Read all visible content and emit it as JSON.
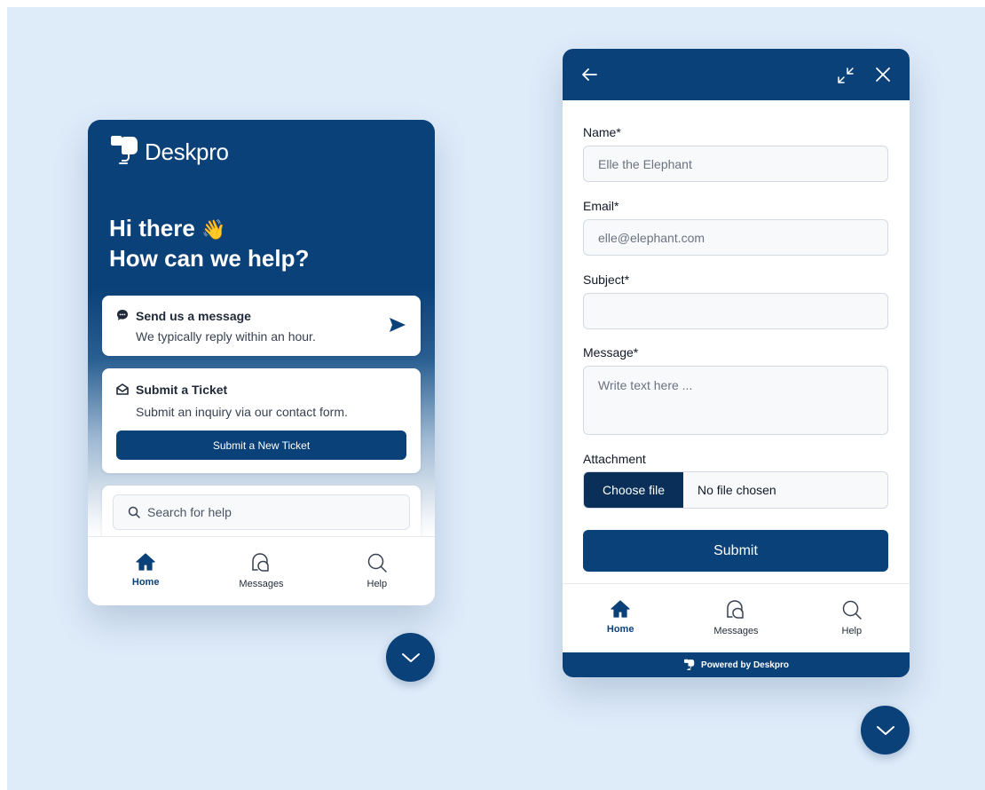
{
  "colors": {
    "brand": "#0a4179",
    "background": "#deebf9",
    "surface": "#ffffff"
  },
  "home_widget": {
    "logo_text": "Deskpro",
    "greeting_line1": "Hi there",
    "greeting_emoji": "👋",
    "greeting_line2": "How can we help?",
    "message_card": {
      "title": "Send us a message",
      "subtitle": "We typically reply within an hour."
    },
    "ticket_card": {
      "title": "Submit a Ticket",
      "subtitle": "Submit an inquiry via our contact form.",
      "button_label": "Submit a New Ticket"
    },
    "search": {
      "placeholder": "Search for help"
    },
    "nav": [
      {
        "label": "Home",
        "icon": "home-icon",
        "active": true
      },
      {
        "label": "Messages",
        "icon": "messages-icon",
        "active": false
      },
      {
        "label": "Help",
        "icon": "search-icon",
        "active": false
      }
    ]
  },
  "ticket_widget": {
    "form": {
      "name": {
        "label": "Name*",
        "placeholder": "Elle the Elephant"
      },
      "email": {
        "label": "Email*",
        "placeholder": "elle@elephant.com"
      },
      "subject": {
        "label": "Subject*",
        "placeholder": ""
      },
      "message": {
        "label": "Message*",
        "placeholder": "Write text here ..."
      },
      "attachment": {
        "label": "Attachment",
        "button_label": "Choose file",
        "status": "No file chosen"
      },
      "submit_label": "Submit"
    },
    "nav": [
      {
        "label": "Home",
        "icon": "home-icon",
        "active": true
      },
      {
        "label": "Messages",
        "icon": "messages-icon",
        "active": false
      },
      {
        "label": "Help",
        "icon": "search-icon",
        "active": false
      }
    ],
    "powered_by": "Powered by Deskpro"
  }
}
